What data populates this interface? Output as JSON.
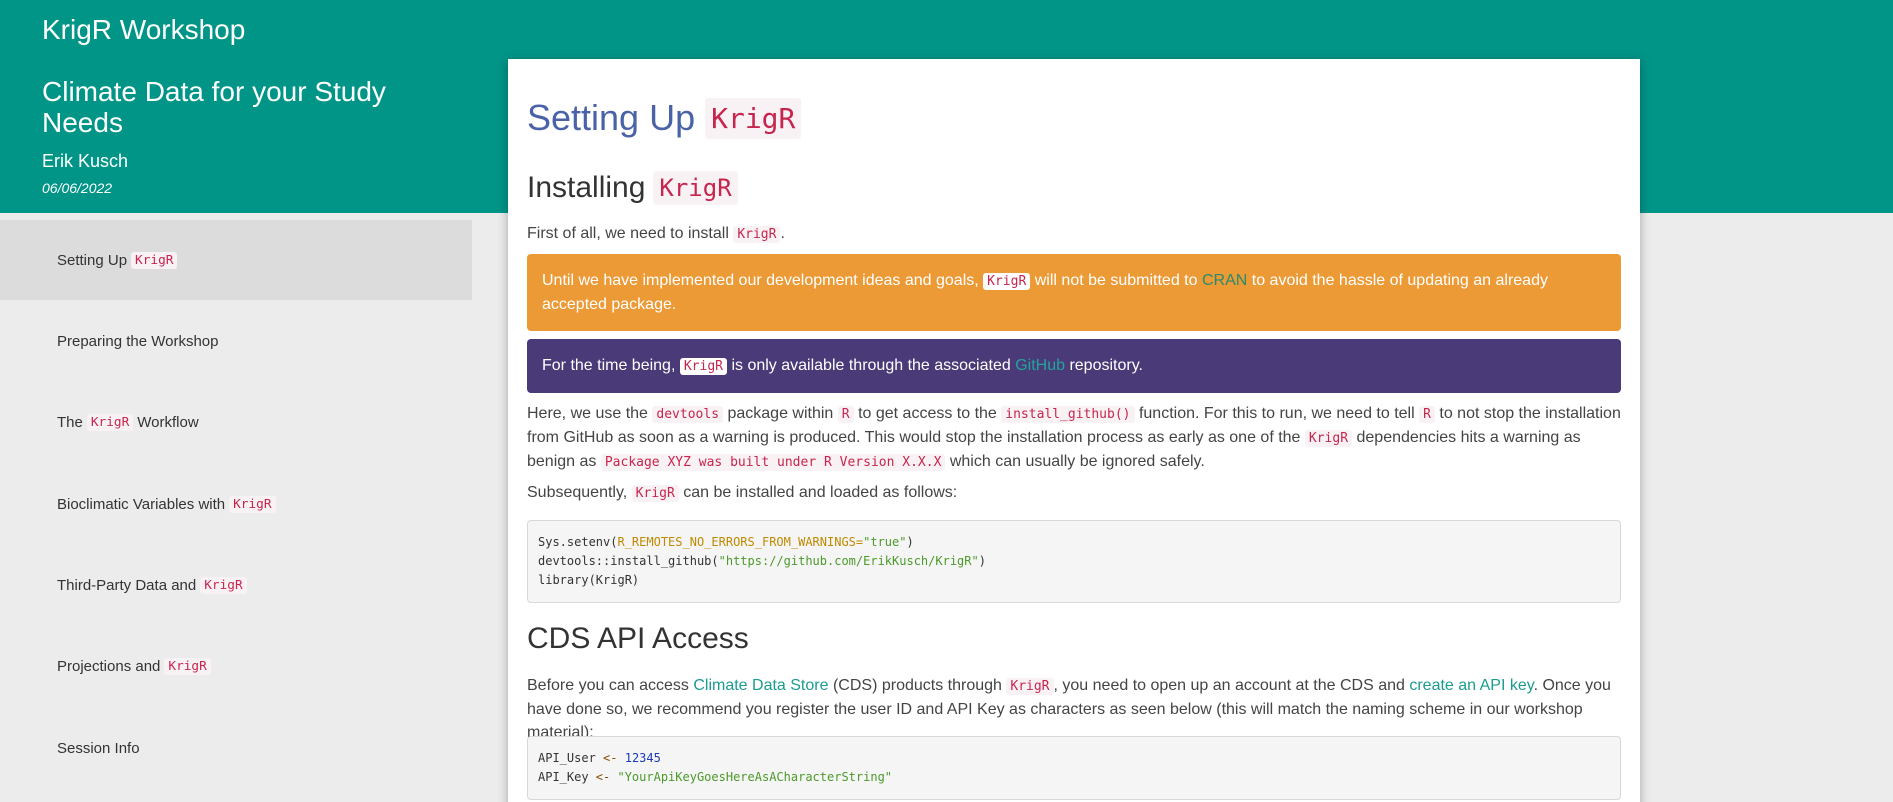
{
  "header": {
    "title": "KrigR Workshop",
    "subtitle": "Climate Data for your Study Needs",
    "author": "Erik Kusch",
    "date": "06/06/2022"
  },
  "sidebar": {
    "items": [
      {
        "pre": "Setting Up ",
        "code": "KrigR",
        "post": ""
      },
      {
        "pre": "Preparing the Workshop",
        "code": "",
        "post": ""
      },
      {
        "pre": "The ",
        "code": "KrigR",
        "post": " Workflow"
      },
      {
        "pre": "Bioclimatic Variables with ",
        "code": "KrigR",
        "post": ""
      },
      {
        "pre": "Third-Party Data and ",
        "code": "KrigR",
        "post": ""
      },
      {
        "pre": "Projections and ",
        "code": "KrigR",
        "post": ""
      },
      {
        "pre": "Session Info",
        "code": "",
        "post": ""
      }
    ]
  },
  "main": {
    "title_text": "Setting Up",
    "title_code": "KrigR",
    "section1": {
      "heading_text": "Installing",
      "heading_code": "KrigR",
      "intro_pre": "First of all, we need to install",
      "intro_code": "KrigR",
      "intro_post": ".",
      "callout_orange": {
        "pre": "Until we have implemented our development ideas and goals,",
        "code": "KrigR",
        "mid": "will not be submitted to",
        "link": "CRAN",
        "post": "to avoid the hassle of updating an already accepted package."
      },
      "callout_purple": {
        "pre": "For the time being,",
        "code": "KrigR",
        "mid": "is only available through the associated",
        "link": "GitHub",
        "post": "repository."
      },
      "para": {
        "t1": "Here, we use the",
        "c1": "devtools",
        "t2": "package within",
        "c2": "R",
        "t3": "to get access to the",
        "c3": "install_github()",
        "t4": "function. For this to run, we need to tell",
        "c4": "R",
        "t5": "to not stop the installation from GitHub as soon as a warning is produced. This would stop the installation process as early as one of the",
        "c5": "KrigR",
        "t6": "dependencies hits a warning as benign as",
        "c6": "Package XYZ was built under R Version X.X.X",
        "t7": "which can usually be ignored safely."
      },
      "sub_pre": "Subsequently,",
      "sub_code": "KrigR",
      "sub_post": "can be installed and loaded as follows:",
      "code_lines": {
        "l1_fn": "Sys.setenv(",
        "l1_arg": "R_REMOTES_NO_ERRORS_FROM_WARNINGS=",
        "l1_str": "\"true\"",
        "l1_end": ")",
        "l2_fn": "devtools::install_github(",
        "l2_str": "\"https://github.com/ErikKusch/KrigR\"",
        "l2_end": ")",
        "l3": "library(KrigR)"
      }
    },
    "section2": {
      "heading": "CDS API Access",
      "para": {
        "t1": "Before you can access",
        "link1": "Climate Data Store",
        "t2": "(CDS) products through",
        "c1": "KrigR",
        "t3": ", you need to open up an account at the CDS and",
        "link2": "create an API key",
        "t4": ". Once you have done so, we recommend you register the user ID and API Key as characters as seen below (this will match the naming scheme in our workshop material):"
      },
      "code_lines": {
        "l1_var": "API_User ",
        "l1_op": "<-",
        "l1_num": "12345",
        "l2_var": "API_Key ",
        "l2_op": "<-",
        "l2_str": "\"YourApiKeyGoesHereAsACharacterString\""
      }
    }
  }
}
